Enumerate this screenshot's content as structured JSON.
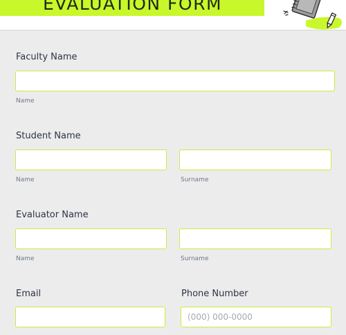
{
  "header": {
    "title": "EVALUATION FORM"
  },
  "colors": {
    "accent": "#c8f72b",
    "field_border": "#c6ee3e",
    "background": "#ececec"
  },
  "icons": [
    "notebook-illustration",
    "pencil-icon"
  ],
  "form": {
    "faculty": {
      "label": "Faculty Name",
      "value": "",
      "sublabel": "Name"
    },
    "student": {
      "label": "Student Name",
      "first_value": "",
      "first_sublabel": "Name",
      "last_value": "",
      "last_sublabel": "Surname"
    },
    "evaluator": {
      "label": "Evaluator Name",
      "first_value": "",
      "first_sublabel": "Name",
      "last_value": "",
      "last_sublabel": "Surname"
    },
    "email": {
      "label": "Email",
      "value": ""
    },
    "phone": {
      "label": "Phone Number",
      "value": "",
      "placeholder": "(000) 000-0000"
    }
  }
}
